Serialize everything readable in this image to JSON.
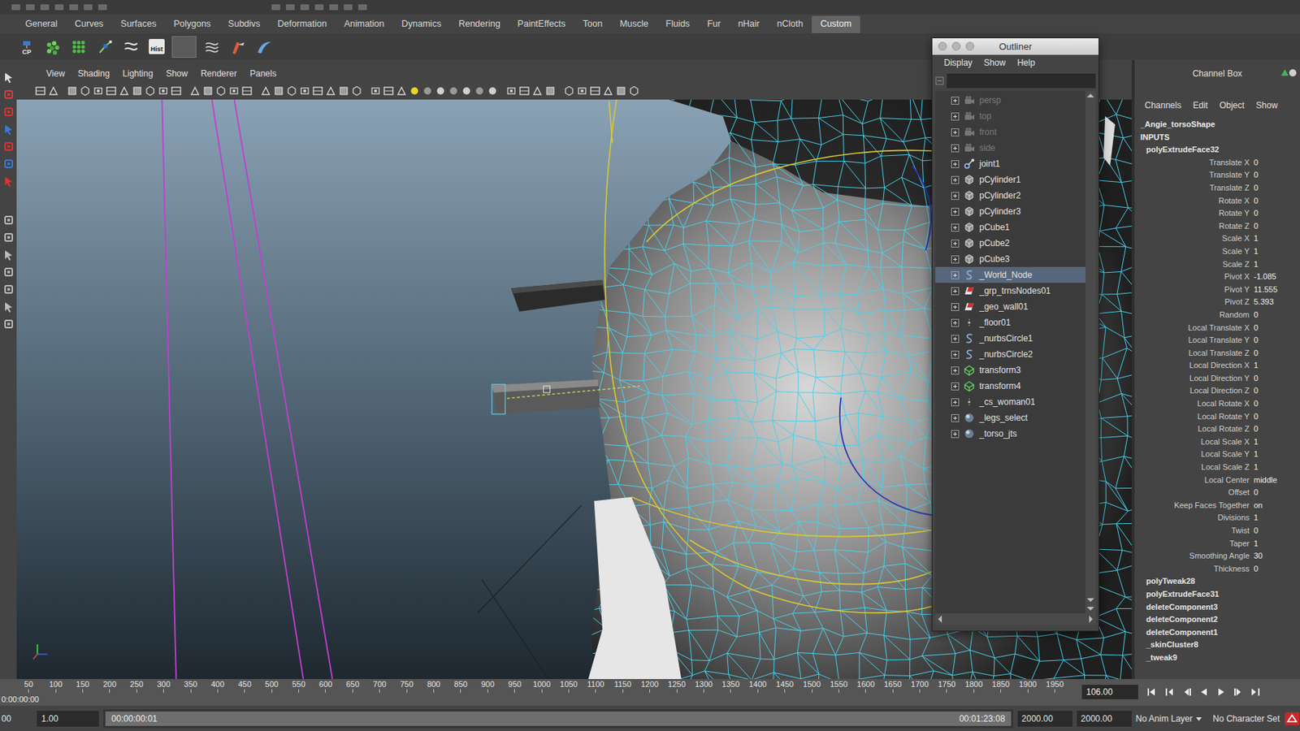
{
  "shelf_tabs": [
    {
      "label": "General",
      "selected": false
    },
    {
      "label": "Curves",
      "selected": false
    },
    {
      "label": "Surfaces",
      "selected": false
    },
    {
      "label": "Polygons",
      "selected": false
    },
    {
      "label": "Subdivs",
      "selected": false
    },
    {
      "label": "Deformation",
      "selected": false
    },
    {
      "label": "Animation",
      "selected": false
    },
    {
      "label": "Dynamics",
      "selected": false
    },
    {
      "label": "Rendering",
      "selected": false
    },
    {
      "label": "PaintEffects",
      "selected": false
    },
    {
      "label": "Toon",
      "selected": false
    },
    {
      "label": "Muscle",
      "selected": false
    },
    {
      "label": "Fluids",
      "selected": false
    },
    {
      "label": "Fur",
      "selected": false
    },
    {
      "label": "nHair",
      "selected": false
    },
    {
      "label": "nCloth",
      "selected": false
    },
    {
      "label": "Custom",
      "selected": true
    }
  ],
  "shelf_buttons": [
    {
      "label": "CP"
    },
    {
      "label": "Hist"
    }
  ],
  "viewport": {
    "menu": [
      "View",
      "Shading",
      "Lighting",
      "Show",
      "Renderer",
      "Panels"
    ]
  },
  "outliner": {
    "title": "Outliner",
    "menu": [
      "Display",
      "Show",
      "Help"
    ],
    "items": [
      {
        "label": "persp",
        "kind": "camera",
        "dimmed": true,
        "selected": false,
        "expanded": false
      },
      {
        "label": "top",
        "kind": "camera",
        "dimmed": true,
        "selected": false,
        "expanded": false
      },
      {
        "label": "front",
        "kind": "camera",
        "dimmed": true,
        "selected": false,
        "expanded": false
      },
      {
        "label": "side",
        "kind": "camera",
        "dimmed": true,
        "selected": false,
        "expanded": false
      },
      {
        "label": "joint1",
        "kind": "joint",
        "dimmed": false,
        "selected": false,
        "expanded": false
      },
      {
        "label": "pCylinder1",
        "kind": "mesh",
        "dimmed": false,
        "selected": false,
        "expanded": false
      },
      {
        "label": "pCylinder2",
        "kind": "mesh",
        "dimmed": false,
        "selected": false,
        "expanded": false
      },
      {
        "label": "pCylinder3",
        "kind": "mesh",
        "dimmed": false,
        "selected": false,
        "expanded": false
      },
      {
        "label": "pCube1",
        "kind": "mesh",
        "dimmed": false,
        "selected": false,
        "expanded": false
      },
      {
        "label": "pCube2",
        "kind": "mesh",
        "dimmed": false,
        "selected": false,
        "expanded": false
      },
      {
        "label": "pCube3",
        "kind": "mesh",
        "dimmed": false,
        "selected": false,
        "expanded": false
      },
      {
        "label": "_World_Node",
        "kind": "curve",
        "dimmed": false,
        "selected": true,
        "expanded": false
      },
      {
        "label": "_grp_trnsNodes01",
        "kind": "group",
        "dimmed": false,
        "selected": false,
        "expanded": false
      },
      {
        "label": "_geo_wall01",
        "kind": "group",
        "dimmed": false,
        "selected": false,
        "expanded": false
      },
      {
        "label": "_floor01",
        "kind": "locator",
        "dimmed": false,
        "selected": false,
        "expanded": false
      },
      {
        "label": "_nurbsCircle1",
        "kind": "curve",
        "dimmed": false,
        "selected": false,
        "expanded": false
      },
      {
        "label": "_nurbsCircle2",
        "kind": "curve",
        "dimmed": false,
        "selected": false,
        "expanded": false
      },
      {
        "label": "transform3",
        "kind": "lattice",
        "dimmed": false,
        "selected": false,
        "expanded": false
      },
      {
        "label": "transform4",
        "kind": "lattice",
        "dimmed": false,
        "selected": false,
        "expanded": false
      },
      {
        "label": "_cs_woman01",
        "kind": "locator",
        "dimmed": false,
        "selected": false,
        "expanded": false
      },
      {
        "label": "_legs_select",
        "kind": "set",
        "dimmed": false,
        "selected": false,
        "expanded": false
      },
      {
        "label": "_torso_jts",
        "kind": "set",
        "dimmed": false,
        "selected": false,
        "expanded": false
      }
    ]
  },
  "channel_box": {
    "title": "Channel Box",
    "menu": [
      "Channels",
      "Edit",
      "Object",
      "Show"
    ],
    "object": "_Angie_torsoShape",
    "section": "INPUTS",
    "node": "polyExtrudeFace32",
    "attributes": [
      {
        "name": "Translate X",
        "value": "0"
      },
      {
        "name": "Translate Y",
        "value": "0"
      },
      {
        "name": "Translate Z",
        "value": "0"
      },
      {
        "name": "Rotate X",
        "value": "0"
      },
      {
        "name": "Rotate Y",
        "value": "0"
      },
      {
        "name": "Rotate Z",
        "value": "0"
      },
      {
        "name": "Scale X",
        "value": "1"
      },
      {
        "name": "Scale Y",
        "value": "1"
      },
      {
        "name": "Scale Z",
        "value": "1"
      },
      {
        "name": "Pivot X",
        "value": "-1.085"
      },
      {
        "name": "Pivot Y",
        "value": "11.555"
      },
      {
        "name": "Pivot Z",
        "value": "5.393"
      },
      {
        "name": "Random",
        "value": "0"
      },
      {
        "name": "Local Translate X",
        "value": "0"
      },
      {
        "name": "Local Translate Y",
        "value": "0"
      },
      {
        "name": "Local Translate Z",
        "value": "0"
      },
      {
        "name": "Local Direction X",
        "value": "1"
      },
      {
        "name": "Local Direction Y",
        "value": "0"
      },
      {
        "name": "Local Direction Z",
        "value": "0"
      },
      {
        "name": "Local Rotate X",
        "value": "0"
      },
      {
        "name": "Local Rotate Y",
        "value": "0"
      },
      {
        "name": "Local Rotate Z",
        "value": "0"
      },
      {
        "name": "Local Scale X",
        "value": "1"
      },
      {
        "name": "Local Scale Y",
        "value": "1"
      },
      {
        "name": "Local Scale Z",
        "value": "1"
      },
      {
        "name": "Local Center",
        "value": "middle"
      },
      {
        "name": "Offset",
        "value": "0"
      },
      {
        "name": "Keep Faces Together",
        "value": "on"
      },
      {
        "name": "Divisions",
        "value": "1"
      },
      {
        "name": "Twist",
        "value": "0"
      },
      {
        "name": "Taper",
        "value": "1"
      },
      {
        "name": "Smoothing Angle",
        "value": "30"
      },
      {
        "name": "Thickness",
        "value": "0"
      }
    ],
    "other_nodes": [
      "polyTweak28",
      "polyExtrudeFace31",
      "deleteComponent3",
      "deleteComponent2",
      "deleteComponent1",
      "_skinCluster8",
      "_tweak9"
    ]
  },
  "time_slider": {
    "ticks": [
      "50",
      "100",
      "150",
      "200",
      "250",
      "300",
      "350",
      "400",
      "450",
      "500",
      "550",
      "600",
      "650",
      "700",
      "750",
      "800",
      "850",
      "900",
      "950",
      "1000",
      "1050",
      "1100",
      "1150",
      "1200",
      "1250",
      "1300",
      "1350",
      "1400",
      "1450",
      "1500",
      "1550",
      "1600",
      "1650",
      "1700",
      "1750",
      "1800",
      "1850",
      "1900",
      "1950"
    ],
    "timecode": "0:00:00:00",
    "current": "106.00"
  },
  "range_slider": {
    "start": "00",
    "inner_start": "1.00",
    "range_start": "00:00:00:01",
    "range_end": "00:01:23:08",
    "inner_end": "2000.00",
    "end": "2000.00",
    "anim_layer": "No Anim Layer",
    "character_set": "No Character Set"
  }
}
